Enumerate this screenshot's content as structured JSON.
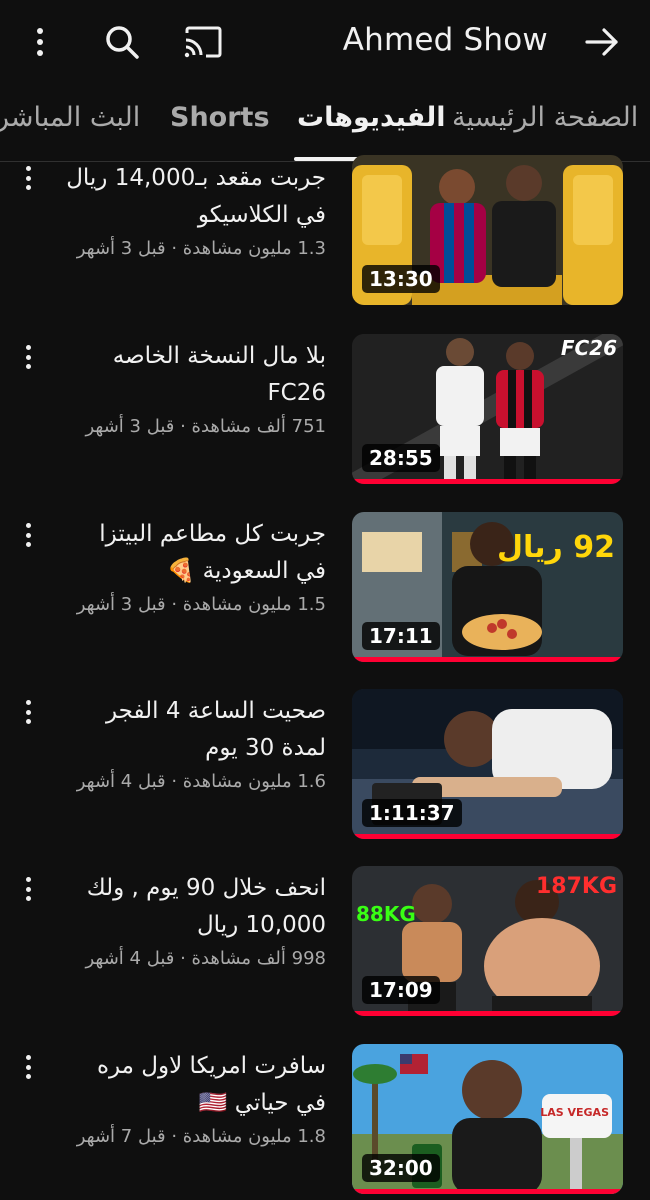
{
  "header": {
    "channel_title": "Ahmed Show",
    "icons": [
      "more-vert-icon",
      "search-icon",
      "cast-icon",
      "arrow-forward-icon"
    ]
  },
  "tabs": [
    {
      "label": "الصفحة الرئيسية",
      "selected": false
    },
    {
      "label": "الفيديوهات",
      "selected": true
    },
    {
      "label": "Shorts",
      "selected": false
    },
    {
      "label": "البث المباشر",
      "selected": false
    }
  ],
  "videos": [
    {
      "title": "جربت مقعد بـ14,000 ريال في الكلاسيكو",
      "meta": "1.3 مليون مشاهدة · قبل 3 أشهر",
      "duration": "13:30"
    },
    {
      "title": "بلا مال النسخة الخاصه FC26",
      "meta": "751 ألف مشاهدة · قبل 3 أشهر",
      "duration": "28:55",
      "thumb_badge": "FC26"
    },
    {
      "title": "جربت كل مطاعم البيتزا في السعودية 🍕",
      "meta": "1.5 مليون مشاهدة · قبل 3 أشهر",
      "duration": "17:11",
      "thumb_text": "92 ريال"
    },
    {
      "title": "صحيت الساعة 4 الفجر لمدة 30 يوم",
      "meta": "1.6 مليون مشاهدة · قبل 4 أشهر",
      "duration": "1:11:37"
    },
    {
      "title": "انحف خلال 90 يوم , ولك 10,000 ريال",
      "meta": "998 ألف مشاهدة · قبل 4 أشهر",
      "duration": "17:09",
      "thumb_left": "88KG",
      "thumb_right": "187KG"
    },
    {
      "title": "سافرت امريكا لاول مره في حياتي 🇺🇸",
      "meta": "1.8 مليون مشاهدة · قبل 7 أشهر",
      "duration": "32:00",
      "thumb_sign": "LAS VEGAS"
    }
  ],
  "colors": {
    "background": "#0f0f0f",
    "progress": "#ff0033",
    "text": "#f1f1f1",
    "secondary": "#aaaaaa"
  }
}
